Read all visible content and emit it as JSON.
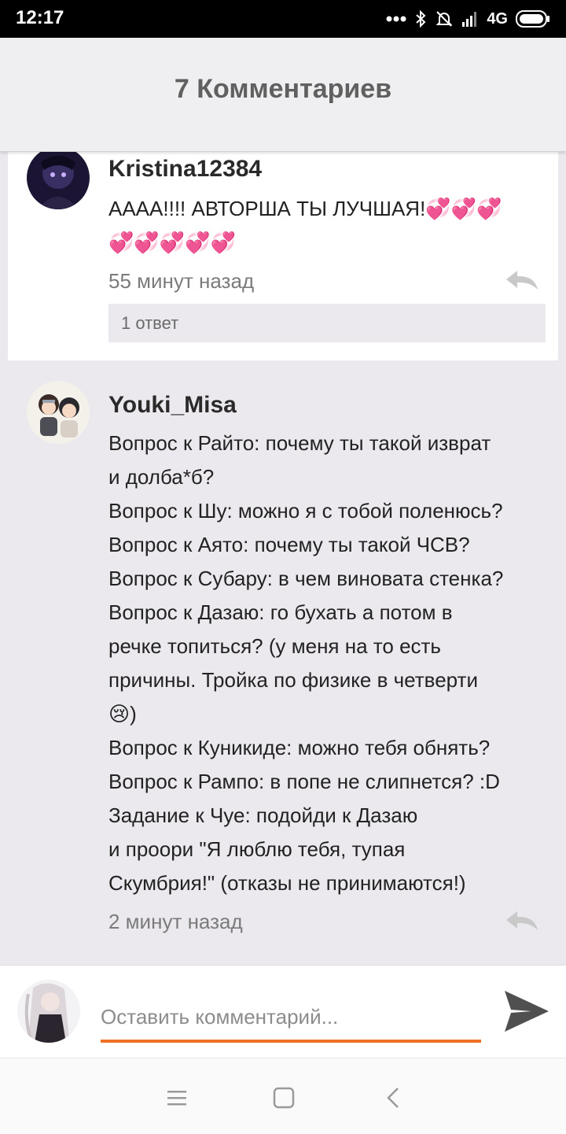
{
  "status_bar": {
    "time": "12:17",
    "network": "4G"
  },
  "header": {
    "title": "7 Комментариев"
  },
  "comments": [
    {
      "username": "Kristina12384",
      "text": "АААА!!!! АВТОРША ТЫ ЛУЧШАЯ!💞💞💞\n💞💞💞💞💞",
      "time": "55 минут назад",
      "replies": "1 ответ"
    },
    {
      "username": "Youki_Misa",
      "text": "Вопрос к Райто: почему ты такой изврат\nи долба*б?\nВопрос к Шу: можно я с тобой поленюсь?\nВопрос к Аято: почему ты такой ЧСВ?\nВопрос к Субару: в чем виновата стенка?\nВопрос к Дазаю: го бухать а потом в\nречке топиться? (у меня на то есть\nпричины. Тройка по физике в четверти\n😢)\nВопрос к Куникиде: можно тебя обнять?\nВопрос к Рампо: в попе не слипнется? :D\nЗадание к Чуе: подойди к Дазаю\nи проори \"Я люблю тебя, тупая\nСкумбрия!\" (отказы не принимаются!)",
      "time": "2 минут назад"
    }
  ],
  "comment_input": {
    "placeholder": "Оставить комментарий..."
  },
  "colors": {
    "accent": "#f07026",
    "background": "#ebe9ee",
    "header_bg": "#efeef0"
  },
  "icons": [
    "bluetooth-icon",
    "bell-off-icon",
    "signal-icon",
    "battery-icon",
    "reply-icon",
    "send-icon",
    "menu-icon",
    "home-icon",
    "back-icon"
  ]
}
